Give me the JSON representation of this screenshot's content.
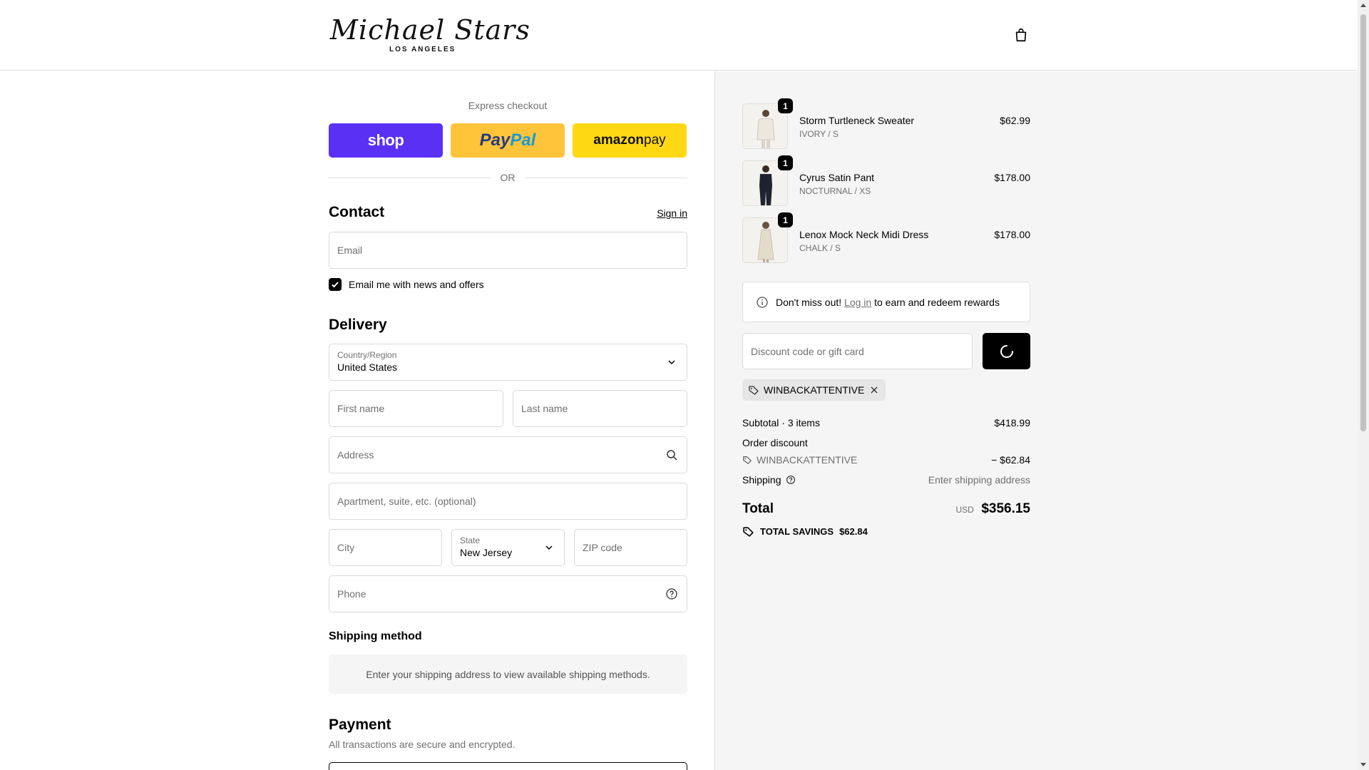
{
  "brand": {
    "name": "Michael Stars",
    "subtitle": "LOS ANGELES"
  },
  "header": {
    "cart_icon": "shopping-bag-icon"
  },
  "express": {
    "title": "Express checkout",
    "shop_label": "shop",
    "paypal_label_1": "Pay",
    "paypal_label_2": "Pal",
    "amazon_label_1": "amazon",
    "amazon_label_2": " pay",
    "or_label": "OR",
    "colors": {
      "shop": "#5a31f4",
      "paypal": "#ffc439",
      "amazon": "#ffd814"
    }
  },
  "contact": {
    "heading": "Contact",
    "sign_in": "Sign in",
    "email_placeholder": "Email",
    "newsletter_label": "Email me with news and offers",
    "newsletter_checked": true
  },
  "delivery": {
    "heading": "Delivery",
    "country_label": "Country/Region",
    "country_value": "United States",
    "first_name_placeholder": "First name",
    "last_name_placeholder": "Last name",
    "address_placeholder": "Address",
    "apartment_placeholder": "Apartment, suite, etc. (optional)",
    "city_placeholder": "City",
    "state_label": "State",
    "state_value": "New Jersey",
    "zip_placeholder": "ZIP code",
    "phone_placeholder": "Phone"
  },
  "shipping_method": {
    "heading": "Shipping method",
    "message": "Enter your shipping address to view available shipping methods."
  },
  "payment": {
    "heading": "Payment",
    "subtitle": "All transactions are secure and encrypted."
  },
  "summary": {
    "items": [
      {
        "qty": "1",
        "name": "Storm Turtleneck Sweater",
        "variant": "IVORY / S",
        "price": "$62.99",
        "color": "#ece8e0"
      },
      {
        "qty": "1",
        "name": "Cyrus Satin Pant",
        "variant": "NOCTURNAL / XS",
        "price": "$178.00",
        "color": "#1f2330"
      },
      {
        "qty": "1",
        "name": "Lenox Mock Neck Midi Dress",
        "variant": "CHALK / S",
        "price": "$178.00",
        "color": "#e4dccb"
      }
    ],
    "rewards_prefix": "Don't miss out! ",
    "rewards_link": "Log in",
    "rewards_suffix": " to earn and redeem rewards",
    "discount_placeholder": "Discount code or gift card",
    "applied_code": "WINBACKATTENTIVE",
    "subtotal_label": "Subtotal · 3 items",
    "subtotal_value": "$418.99",
    "order_discount_label": "Order discount",
    "discount_code": "WINBACKATTENTIVE",
    "discount_value": "− $62.84",
    "shipping_label": "Shipping",
    "shipping_value": "Enter shipping address",
    "total_label": "Total",
    "total_currency": "USD",
    "total_value": "$356.15",
    "savings_label": "TOTAL SAVINGS",
    "savings_value": "$62.84"
  }
}
